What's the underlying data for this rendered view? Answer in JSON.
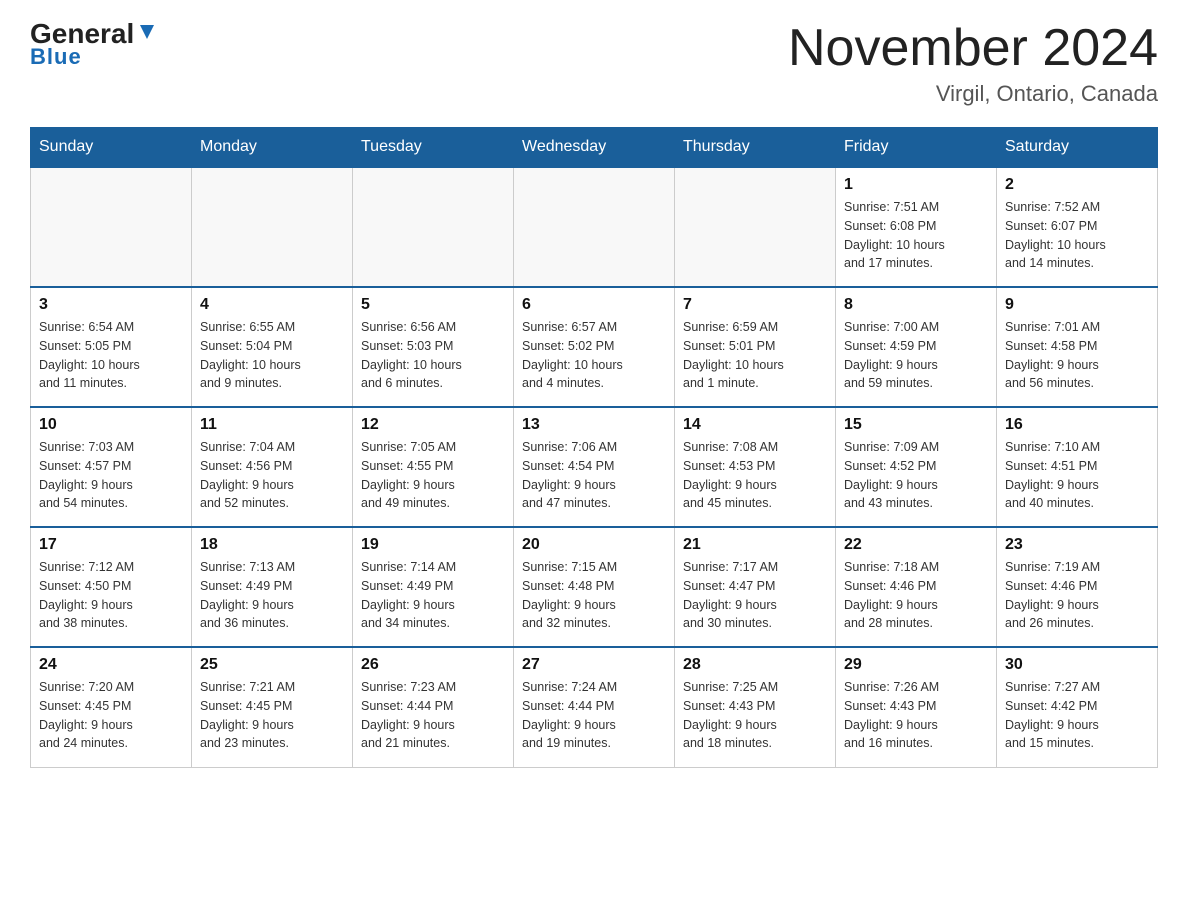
{
  "logo": {
    "general": "General",
    "triangle": "▼",
    "blue": "Blue"
  },
  "title": "November 2024",
  "location": "Virgil, Ontario, Canada",
  "headers": [
    "Sunday",
    "Monday",
    "Tuesday",
    "Wednesday",
    "Thursday",
    "Friday",
    "Saturday"
  ],
  "weeks": [
    [
      {
        "day": "",
        "info": ""
      },
      {
        "day": "",
        "info": ""
      },
      {
        "day": "",
        "info": ""
      },
      {
        "day": "",
        "info": ""
      },
      {
        "day": "",
        "info": ""
      },
      {
        "day": "1",
        "info": "Sunrise: 7:51 AM\nSunset: 6:08 PM\nDaylight: 10 hours\nand 17 minutes."
      },
      {
        "day": "2",
        "info": "Sunrise: 7:52 AM\nSunset: 6:07 PM\nDaylight: 10 hours\nand 14 minutes."
      }
    ],
    [
      {
        "day": "3",
        "info": "Sunrise: 6:54 AM\nSunset: 5:05 PM\nDaylight: 10 hours\nand 11 minutes."
      },
      {
        "day": "4",
        "info": "Sunrise: 6:55 AM\nSunset: 5:04 PM\nDaylight: 10 hours\nand 9 minutes."
      },
      {
        "day": "5",
        "info": "Sunrise: 6:56 AM\nSunset: 5:03 PM\nDaylight: 10 hours\nand 6 minutes."
      },
      {
        "day": "6",
        "info": "Sunrise: 6:57 AM\nSunset: 5:02 PM\nDaylight: 10 hours\nand 4 minutes."
      },
      {
        "day": "7",
        "info": "Sunrise: 6:59 AM\nSunset: 5:01 PM\nDaylight: 10 hours\nand 1 minute."
      },
      {
        "day": "8",
        "info": "Sunrise: 7:00 AM\nSunset: 4:59 PM\nDaylight: 9 hours\nand 59 minutes."
      },
      {
        "day": "9",
        "info": "Sunrise: 7:01 AM\nSunset: 4:58 PM\nDaylight: 9 hours\nand 56 minutes."
      }
    ],
    [
      {
        "day": "10",
        "info": "Sunrise: 7:03 AM\nSunset: 4:57 PM\nDaylight: 9 hours\nand 54 minutes."
      },
      {
        "day": "11",
        "info": "Sunrise: 7:04 AM\nSunset: 4:56 PM\nDaylight: 9 hours\nand 52 minutes."
      },
      {
        "day": "12",
        "info": "Sunrise: 7:05 AM\nSunset: 4:55 PM\nDaylight: 9 hours\nand 49 minutes."
      },
      {
        "day": "13",
        "info": "Sunrise: 7:06 AM\nSunset: 4:54 PM\nDaylight: 9 hours\nand 47 minutes."
      },
      {
        "day": "14",
        "info": "Sunrise: 7:08 AM\nSunset: 4:53 PM\nDaylight: 9 hours\nand 45 minutes."
      },
      {
        "day": "15",
        "info": "Sunrise: 7:09 AM\nSunset: 4:52 PM\nDaylight: 9 hours\nand 43 minutes."
      },
      {
        "day": "16",
        "info": "Sunrise: 7:10 AM\nSunset: 4:51 PM\nDaylight: 9 hours\nand 40 minutes."
      }
    ],
    [
      {
        "day": "17",
        "info": "Sunrise: 7:12 AM\nSunset: 4:50 PM\nDaylight: 9 hours\nand 38 minutes."
      },
      {
        "day": "18",
        "info": "Sunrise: 7:13 AM\nSunset: 4:49 PM\nDaylight: 9 hours\nand 36 minutes."
      },
      {
        "day": "19",
        "info": "Sunrise: 7:14 AM\nSunset: 4:49 PM\nDaylight: 9 hours\nand 34 minutes."
      },
      {
        "day": "20",
        "info": "Sunrise: 7:15 AM\nSunset: 4:48 PM\nDaylight: 9 hours\nand 32 minutes."
      },
      {
        "day": "21",
        "info": "Sunrise: 7:17 AM\nSunset: 4:47 PM\nDaylight: 9 hours\nand 30 minutes."
      },
      {
        "day": "22",
        "info": "Sunrise: 7:18 AM\nSunset: 4:46 PM\nDaylight: 9 hours\nand 28 minutes."
      },
      {
        "day": "23",
        "info": "Sunrise: 7:19 AM\nSunset: 4:46 PM\nDaylight: 9 hours\nand 26 minutes."
      }
    ],
    [
      {
        "day": "24",
        "info": "Sunrise: 7:20 AM\nSunset: 4:45 PM\nDaylight: 9 hours\nand 24 minutes."
      },
      {
        "day": "25",
        "info": "Sunrise: 7:21 AM\nSunset: 4:45 PM\nDaylight: 9 hours\nand 23 minutes."
      },
      {
        "day": "26",
        "info": "Sunrise: 7:23 AM\nSunset: 4:44 PM\nDaylight: 9 hours\nand 21 minutes."
      },
      {
        "day": "27",
        "info": "Sunrise: 7:24 AM\nSunset: 4:44 PM\nDaylight: 9 hours\nand 19 minutes."
      },
      {
        "day": "28",
        "info": "Sunrise: 7:25 AM\nSunset: 4:43 PM\nDaylight: 9 hours\nand 18 minutes."
      },
      {
        "day": "29",
        "info": "Sunrise: 7:26 AM\nSunset: 4:43 PM\nDaylight: 9 hours\nand 16 minutes."
      },
      {
        "day": "30",
        "info": "Sunrise: 7:27 AM\nSunset: 4:42 PM\nDaylight: 9 hours\nand 15 minutes."
      }
    ]
  ]
}
